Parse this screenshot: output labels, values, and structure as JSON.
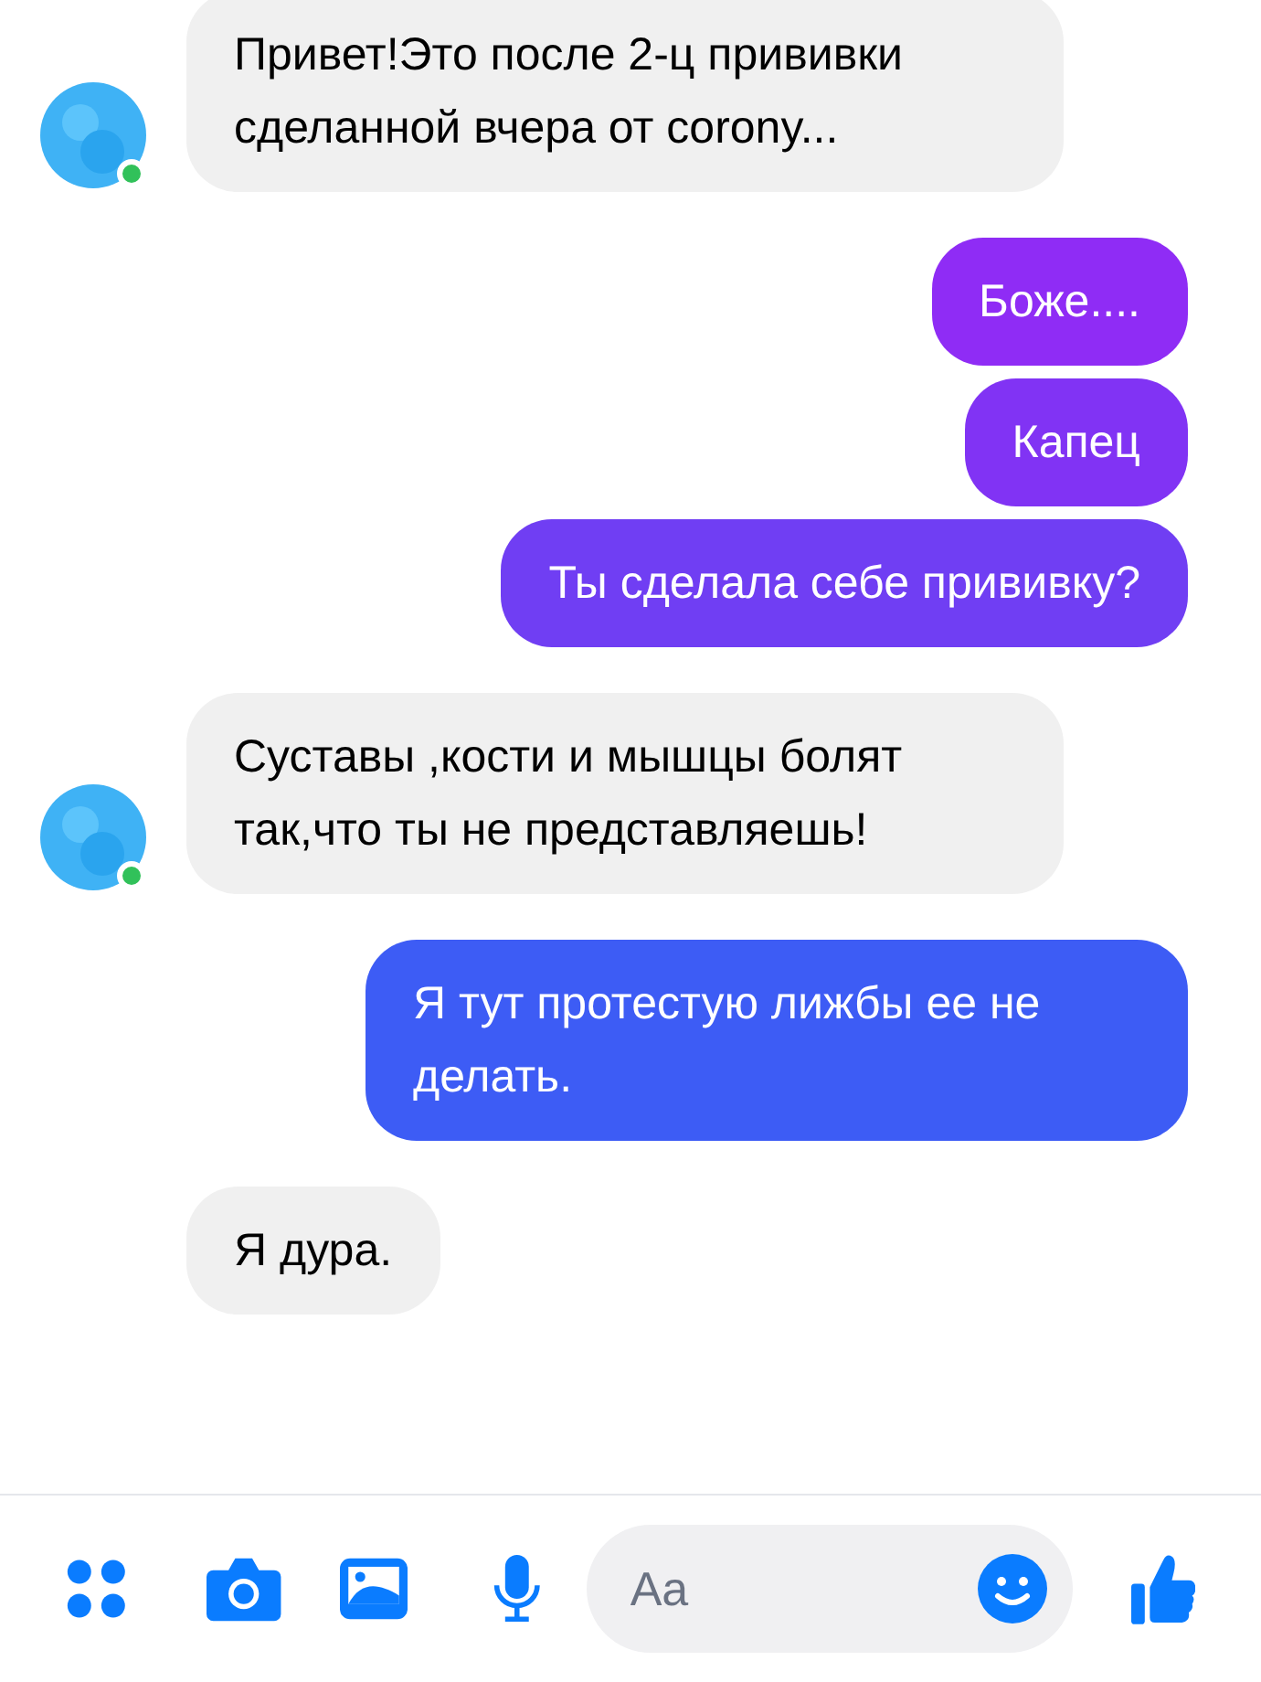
{
  "messages": [
    {
      "kind": "incoming",
      "text": "Привет!Это после 2-ц прививки сделанной вчера от corony...",
      "avatar": {
        "online": true
      }
    },
    {
      "kind": "outgoing",
      "text": "Боже....",
      "color": "#8f2cf5"
    },
    {
      "kind": "outgoing",
      "text": "Капец",
      "color": "#8133f4"
    },
    {
      "kind": "outgoing",
      "text": "Ты сделала себе прививку?",
      "color": "#703ef3"
    },
    {
      "kind": "incoming",
      "text": "Суставы ,кости и мышцы болят так,что ты не представляешь!",
      "avatar": {
        "online": true
      }
    },
    {
      "kind": "outgoing",
      "text": "Я тут протестую лижбы ее не делать.",
      "color": "#3d5cf5"
    },
    {
      "kind": "incoming",
      "text": "Я дура."
    }
  ],
  "composer": {
    "placeholder": "Aa"
  }
}
